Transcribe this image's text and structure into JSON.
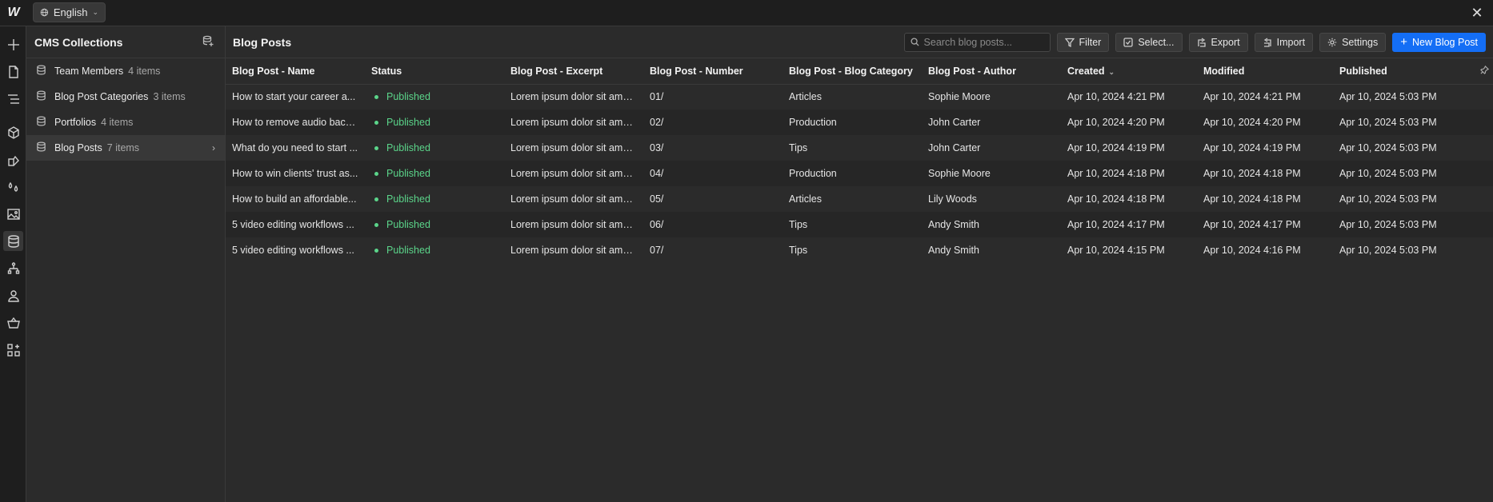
{
  "topbar": {
    "language": "English",
    "logo_glyph": "W"
  },
  "rail": {
    "icons": [
      "add-icon",
      "page-icon",
      "navigator-icon",
      "components-icon",
      "style-manager-icon",
      "variables-icon",
      "assets-icon",
      "cms-icon",
      "logic-icon",
      "users-icon",
      "ecommerce-icon",
      "apps-icon"
    ],
    "active": "cms-icon"
  },
  "sidebar": {
    "title": "CMS Collections",
    "items": [
      {
        "name": "Team Members",
        "count": "4 items"
      },
      {
        "name": "Blog Post Categories",
        "count": "3 items"
      },
      {
        "name": "Portfolios",
        "count": "4 items"
      },
      {
        "name": "Blog Posts",
        "count": "7 items"
      }
    ],
    "active_index": 3
  },
  "main": {
    "title": "Blog Posts",
    "search_placeholder": "Search blog posts...",
    "buttons": {
      "filter": "Filter",
      "select": "Select...",
      "export": "Export",
      "import": "Import",
      "settings": "Settings",
      "new": "New Blog Post"
    },
    "columns": [
      "Blog Post - Name",
      "Status",
      "Blog Post - Excerpt",
      "Blog Post - Number",
      "Blog Post - Blog Category",
      "Blog Post - Author",
      "Created",
      "Modified",
      "Published"
    ],
    "rows": [
      [
        "How to start your career a...",
        "Published",
        "Lorem ipsum dolor sit amet co...",
        "01/",
        "Articles",
        "Sophie Moore",
        "Apr 10, 2024 4:21 PM",
        "Apr 10, 2024 4:21 PM",
        "Apr 10, 2024 5:03 PM"
      ],
      [
        "How to remove audio back...",
        "Published",
        "Lorem ipsum dolor sit amet co...",
        "02/",
        "Production",
        "John Carter",
        "Apr 10, 2024 4:20 PM",
        "Apr 10, 2024 4:20 PM",
        "Apr 10, 2024 5:03 PM"
      ],
      [
        "What do you need to start ...",
        "Published",
        "Lorem ipsum dolor sit amet co...",
        "03/",
        "Tips",
        "John Carter",
        "Apr 10, 2024 4:19 PM",
        "Apr 10, 2024 4:19 PM",
        "Apr 10, 2024 5:03 PM"
      ],
      [
        "How to win clients' trust as...",
        "Published",
        "Lorem ipsum dolor sit amet co...",
        "04/",
        "Production",
        "Sophie Moore",
        "Apr 10, 2024 4:18 PM",
        "Apr 10, 2024 4:18 PM",
        "Apr 10, 2024 5:03 PM"
      ],
      [
        "How to build an affordable...",
        "Published",
        "Lorem ipsum dolor sit amet co...",
        "05/",
        "Articles",
        "Lily Woods",
        "Apr 10, 2024 4:18 PM",
        "Apr 10, 2024 4:18 PM",
        "Apr 10, 2024 5:03 PM"
      ],
      [
        "5 video editing workflows ...",
        "Published",
        "Lorem ipsum dolor sit amet co...",
        "06/",
        "Tips",
        "Andy Smith",
        "Apr 10, 2024 4:17 PM",
        "Apr 10, 2024 4:17 PM",
        "Apr 10, 2024 5:03 PM"
      ],
      [
        "5 video editing workflows ...",
        "Published",
        "Lorem ipsum dolor sit amet co...",
        "07/",
        "Tips",
        "Andy Smith",
        "Apr 10, 2024 4:15 PM",
        "Apr 10, 2024 4:16 PM",
        "Apr 10, 2024 5:03 PM"
      ]
    ]
  },
  "colors": {
    "accent": "#146ef5",
    "published": "#5bd58a",
    "background": "#2b2b2b"
  }
}
